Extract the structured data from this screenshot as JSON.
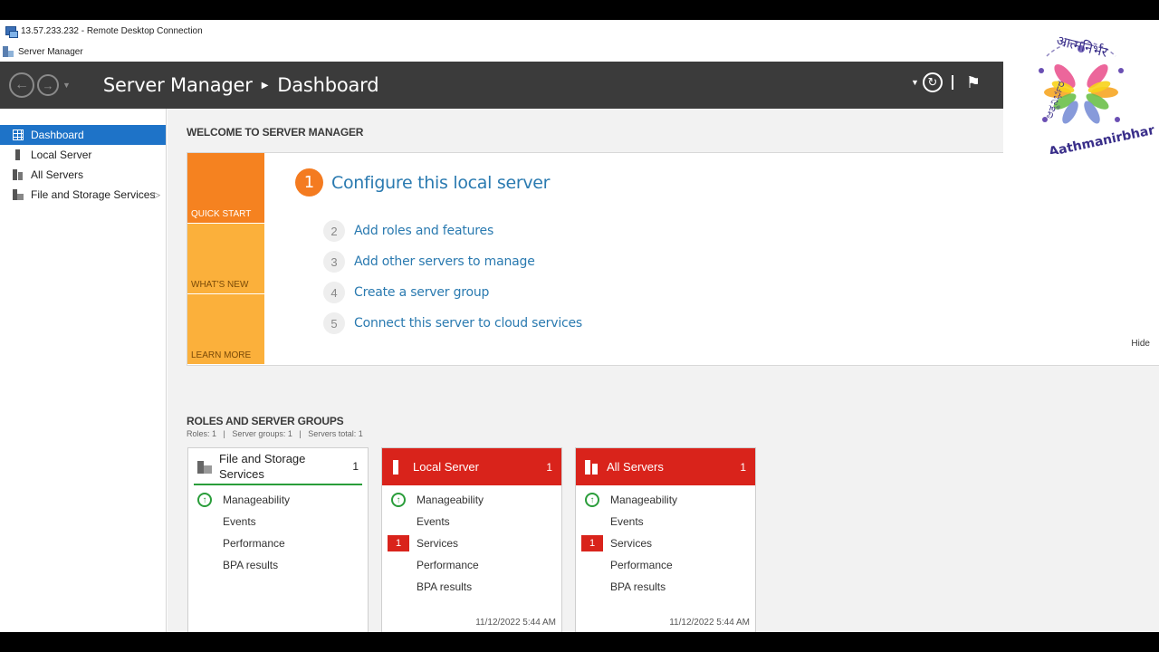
{
  "rdp": {
    "title": "13.57.233.232 - Remote Desktop Connection"
  },
  "app": {
    "title": "Server Manager"
  },
  "header": {
    "breadcrumb_root": "Server Manager",
    "breadcrumb_current": "Dashboard",
    "back_icon": "back-arrow-icon",
    "forward_icon": "forward-arrow-icon"
  },
  "sidebar": {
    "items": [
      {
        "label": "Dashboard",
        "icon": "dashboard-icon",
        "active": true
      },
      {
        "label": "Local Server",
        "icon": "server-icon"
      },
      {
        "label": "All Servers",
        "icon": "servers-icon"
      },
      {
        "label": "File and Storage Services",
        "icon": "storage-icon",
        "has_submenu": true
      }
    ]
  },
  "welcome": {
    "title": "WELCOME TO SERVER MANAGER",
    "tiles": [
      "QUICK START",
      "WHAT'S NEW",
      "LEARN MORE"
    ],
    "primary_step": {
      "num": "1",
      "label": "Configure this local server"
    },
    "steps": [
      {
        "num": "2",
        "label": "Add roles and features"
      },
      {
        "num": "3",
        "label": "Add other servers to manage"
      },
      {
        "num": "4",
        "label": "Create a server group"
      },
      {
        "num": "5",
        "label": "Connect this server to cloud services"
      }
    ],
    "hide": "Hide"
  },
  "roles": {
    "title": "ROLES AND SERVER GROUPS",
    "summary": "Roles: 1   |   Server groups: 1   |   Servers total: 1",
    "cards": [
      {
        "title": "File and Storage Services",
        "count": "1",
        "rows": [
          "Manageability",
          "Events",
          "Performance",
          "BPA results"
        ]
      },
      {
        "title": "Local Server",
        "count": "1",
        "rows": [
          "Manageability",
          "Events",
          "Services",
          "Performance",
          "BPA results"
        ],
        "services_badge": "1",
        "timestamp": "11/12/2022 5:44 AM"
      },
      {
        "title": "All Servers",
        "count": "1",
        "rows": [
          "Manageability",
          "Events",
          "Services",
          "Performance",
          "BPA results"
        ],
        "services_badge": "1",
        "timestamp": "11/12/2022 5:44 AM"
      }
    ]
  },
  "logo": {
    "text": "Aathmanirbhar",
    "devanagari": "आत्मनिर्भर",
    "kannada": "ಆತ್ಮನಿರ್ಭರ"
  },
  "colors": {
    "accent_blue": "#1e73c8",
    "alert_red": "#d9231b",
    "quick_start_orange": "#f58220",
    "tile_yellow": "#fbb03b",
    "link_blue": "#2a7ab0"
  }
}
